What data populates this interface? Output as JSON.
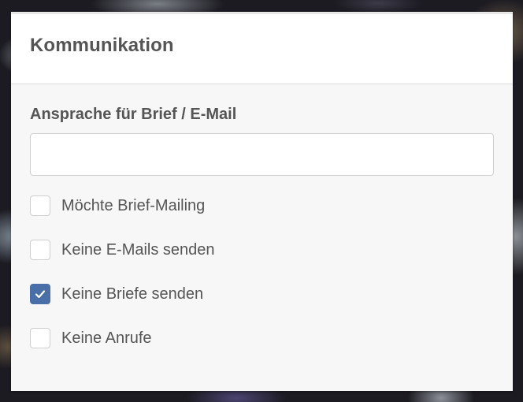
{
  "panel": {
    "title": "Kommunikation"
  },
  "salutation_field": {
    "label": "Ansprache für Brief / E-Mail",
    "value": "",
    "placeholder": ""
  },
  "options": [
    {
      "label": "Möchte Brief-Mailing",
      "checked": false
    },
    {
      "label": "Keine E-Mails senden",
      "checked": false
    },
    {
      "label": "Keine Briefe senden",
      "checked": true
    },
    {
      "label": "Keine Anrufe",
      "checked": false
    }
  ],
  "colors": {
    "accent": "#4a6fa8",
    "panel_background": "#f7f7f7",
    "text": "#555555"
  },
  "icons": {
    "checkmark": "checkmark-icon"
  }
}
